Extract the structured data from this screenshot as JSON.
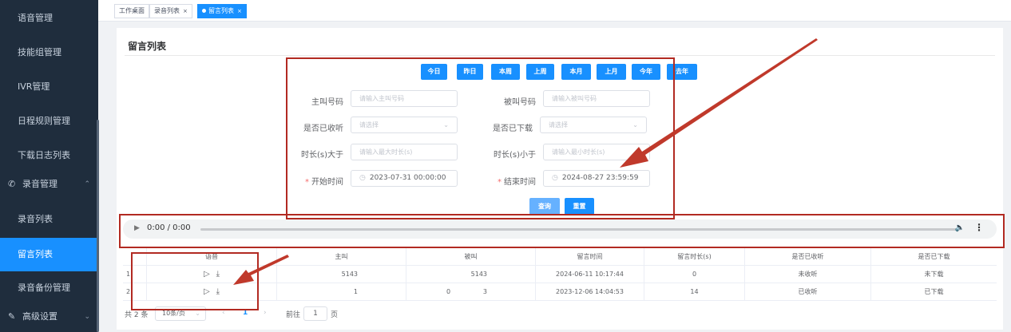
{
  "sidebar": {
    "items": [
      {
        "label": "语音管理"
      },
      {
        "label": "技能组管理"
      },
      {
        "label": "IVR管理"
      },
      {
        "label": "日程规则管理"
      },
      {
        "label": "下载日志列表"
      },
      {
        "label": "录音管理",
        "icon": "phone-icon"
      },
      {
        "label": "录音列表"
      },
      {
        "label": "留言列表"
      },
      {
        "label": "录音备份管理"
      },
      {
        "label": "高级设置",
        "icon": "pen-icon"
      }
    ]
  },
  "tabs": [
    {
      "label": "工作桌面"
    },
    {
      "label": "录音列表",
      "close": "×"
    },
    {
      "label": "留言列表",
      "close": "×"
    }
  ],
  "page": {
    "title": "留言列表"
  },
  "quick_buttons": [
    "今日",
    "昨日",
    "本周",
    "上周",
    "本月",
    "上月",
    "今年",
    "去年"
  ],
  "form": {
    "caller": {
      "label": "主叫号码",
      "placeholder": "请输入主叫号码"
    },
    "callee": {
      "label": "被叫号码",
      "placeholder": "请输入被叫号码"
    },
    "listened": {
      "label": "是否已收听",
      "placeholder": "请选择"
    },
    "downloaded": {
      "label": "是否已下载",
      "placeholder": "请选择"
    },
    "duration_gt": {
      "label": "时长(s)大于",
      "placeholder": "请输入最大时长(s)"
    },
    "duration_lt": {
      "label": "时长(s)小于",
      "placeholder": "请输入最小时长(s)"
    },
    "start_time": {
      "label": "开始时间",
      "value": "2023-07-31 00:00:00"
    },
    "end_time": {
      "label": "结束时间",
      "value": "2024-08-27 23:59:59"
    },
    "required_mark": "*",
    "search_label": "查询",
    "reset_label": "重置"
  },
  "player": {
    "time": "0:00 / 0:00"
  },
  "table": {
    "headers": [
      "",
      "语音",
      "主叫",
      "被叫",
      "留言时间",
      "留言时长(s)",
      "是否已收听",
      "是否已下载"
    ],
    "rows": [
      {
        "index": "1",
        "caller": "5143",
        "callee": "5143",
        "time": "2024-06-11 10:17:44",
        "duration": "0",
        "listened": "未收听",
        "downloaded": "未下载"
      },
      {
        "index": "2",
        "caller": "1",
        "callee": "3",
        "callee_prefix": "0",
        "time": "2023-12-06 14:04:53",
        "duration": "14",
        "listened": "已收听",
        "downloaded": "已下载"
      }
    ]
  },
  "pagination": {
    "total": "共 2 条",
    "page_size": "10条/页",
    "current": "1",
    "goto_prefix": "前往",
    "goto_value": "1",
    "goto_suffix": "页"
  },
  "colors": {
    "accent": "#1890ff",
    "sidebar": "#1f2d3d",
    "annotation": "#b22a22"
  }
}
